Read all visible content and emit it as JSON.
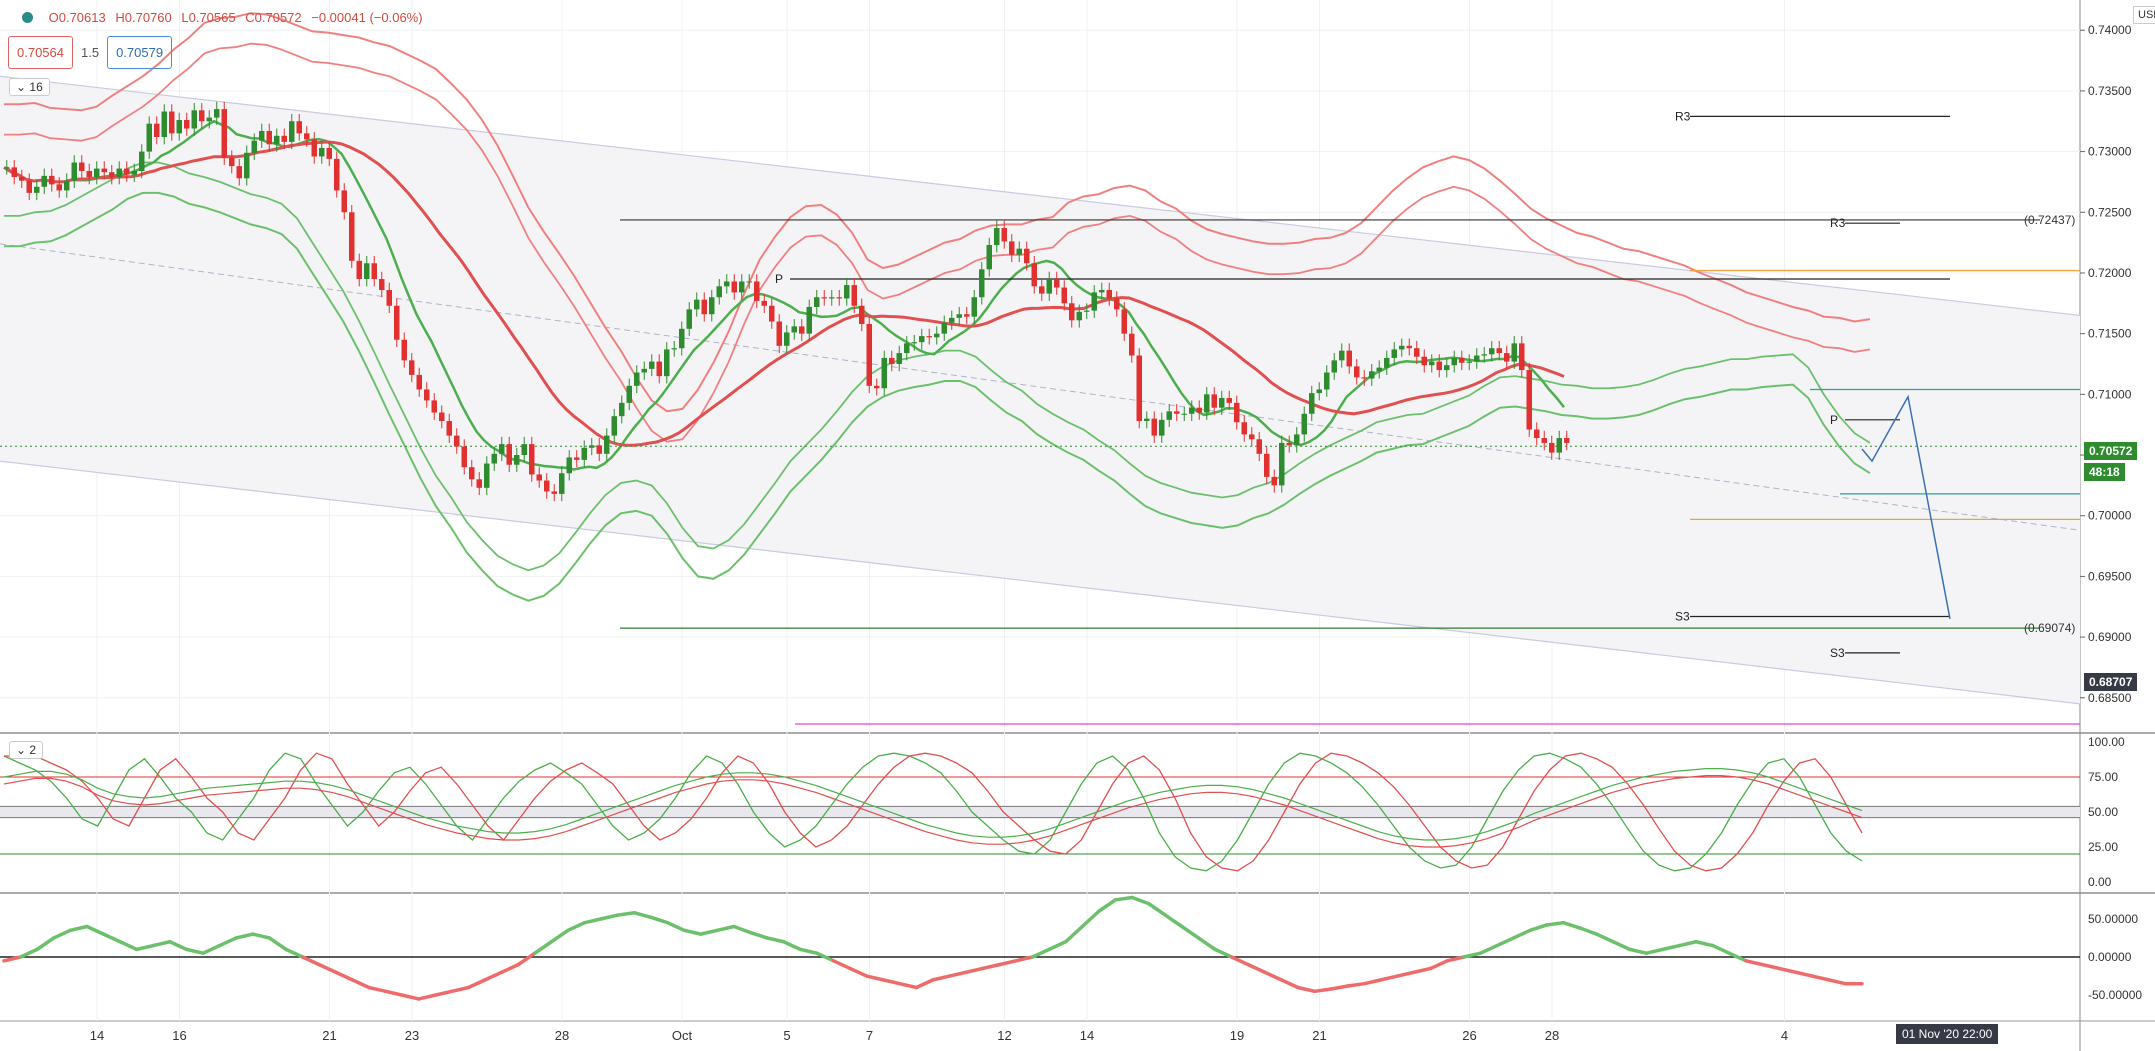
{
  "header": {
    "ohlc": {
      "open": "O0.70613",
      "high": "H0.70760",
      "low": "L0.70565",
      "close": "C0.70572",
      "change": "−0.00041 (−0.06%)"
    },
    "bid": "0.70564",
    "spread": "1.5",
    "ask": "0.70579",
    "indicator_count_main": "16",
    "indicator_count_osc": "2",
    "currency": "USD"
  },
  "price_axis": {
    "labels": [
      "0.74000",
      "0.73500",
      "0.73000",
      "0.72500",
      "0.72000",
      "0.71500",
      "0.71000",
      "0.70500",
      "0.70000",
      "0.69500",
      "0.69000",
      "0.68500"
    ],
    "values": [
      0.74,
      0.735,
      0.73,
      0.725,
      0.72,
      0.715,
      0.71,
      0.705,
      0.7,
      0.695,
      0.69,
      0.685
    ],
    "current_price": "0.70572",
    "countdown": "48:18",
    "crosshair_price": "0.68707"
  },
  "osc_axis": {
    "labels": [
      "100.00",
      "75.00",
      "50.00",
      "25.00",
      "0.00"
    ],
    "values": [
      100,
      75,
      50,
      25,
      0
    ]
  },
  "mom_axis": {
    "labels": [
      "50.00000",
      "0.00000",
      "-50.00000"
    ],
    "values": [
      50,
      0,
      -50
    ]
  },
  "time_axis": {
    "labels": [
      "14",
      "16",
      "21",
      "23",
      "28",
      "Oct",
      "5",
      "7",
      "12",
      "14",
      "19",
      "21",
      "26",
      "28",
      "4"
    ],
    "x_index": [
      12,
      23,
      43,
      54,
      74,
      90,
      104,
      115,
      133,
      144,
      164,
      175,
      195,
      206,
      237
    ],
    "current_date": "01 Nov '20   22:00"
  },
  "levels": {
    "R3_left": {
      "label": "R3",
      "price": 0.7329
    },
    "R3_right": {
      "label": "R3",
      "price": 0.7241
    },
    "S3_left": {
      "label": "S3",
      "price": 0.6917
    },
    "S3_right": {
      "label": "S3",
      "price": 0.6887
    },
    "P_left": {
      "label": "P",
      "price": 0.7195
    },
    "P_right": {
      "label": "P",
      "price": 0.7079
    },
    "high_label": "(0.72437)",
    "low_label": "(0.69074)"
  },
  "chart_data": {
    "type": "candlestick",
    "title": "",
    "colors": {
      "up": "#2e8b2e",
      "down": "#e03030",
      "upper_band": "#f08080",
      "lower_band": "#6cc06c"
    },
    "ylim": [
      0.6835,
      0.7415
    ],
    "closes": [
      0.7287,
      0.7279,
      0.7276,
      0.7266,
      0.7271,
      0.728,
      0.7273,
      0.7268,
      0.7276,
      0.7291,
      0.7284,
      0.7279,
      0.7286,
      0.7283,
      0.7279,
      0.7286,
      0.7281,
      0.7284,
      0.73,
      0.7323,
      0.7312,
      0.7333,
      0.7315,
      0.7326,
      0.7319,
      0.7334,
      0.7325,
      0.7328,
      0.7335,
      0.7295,
      0.7288,
      0.7278,
      0.7299,
      0.7309,
      0.7317,
      0.7306,
      0.7313,
      0.7308,
      0.7325,
      0.7315,
      0.731,
      0.7296,
      0.7303,
      0.7294,
      0.7268,
      0.725,
      0.721,
      0.7195,
      0.7208,
      0.7195,
      0.7186,
      0.7173,
      0.7145,
      0.7128,
      0.7116,
      0.7104,
      0.7095,
      0.7085,
      0.7078,
      0.7066,
      0.7057,
      0.704,
      0.703,
      0.7023,
      0.7043,
      0.7051,
      0.7059,
      0.7042,
      0.705,
      0.7059,
      0.7034,
      0.7029,
      0.702,
      0.7018,
      0.7035,
      0.7048,
      0.7046,
      0.7056,
      0.7058,
      0.7051,
      0.7066,
      0.7082,
      0.7093,
      0.7107,
      0.7118,
      0.7121,
      0.7127,
      0.7115,
      0.7137,
      0.7138,
      0.7154,
      0.717,
      0.7178,
      0.7166,
      0.718,
      0.7189,
      0.7193,
      0.7184,
      0.7193,
      0.7193,
      0.7177,
      0.7173,
      0.716,
      0.714,
      0.7151,
      0.7156,
      0.715,
      0.7172,
      0.718,
      0.7179,
      0.718,
      0.7179,
      0.719,
      0.7173,
      0.7158,
      0.7107,
      0.7105,
      0.713,
      0.7125,
      0.7134,
      0.7142,
      0.7143,
      0.7148,
      0.7147,
      0.715,
      0.7159,
      0.7163,
      0.7166,
      0.7164,
      0.718,
      0.7203,
      0.7223,
      0.7237,
      0.7226,
      0.7215,
      0.722,
      0.7208,
      0.7189,
      0.7183,
      0.7195,
      0.7188,
      0.7175,
      0.7161,
      0.7168,
      0.7169,
      0.7184,
      0.7186,
      0.7179,
      0.717,
      0.715,
      0.7132,
      0.7078,
      0.708,
      0.7066,
      0.7079,
      0.7086,
      0.7084,
      0.7084,
      0.7089,
      0.7085,
      0.71,
      0.7089,
      0.7097,
      0.7093,
      0.7077,
      0.7067,
      0.7063,
      0.7051,
      0.7032,
      0.7025,
      0.706,
      0.7058,
      0.7067,
      0.7084,
      0.7101,
      0.7104,
      0.7118,
      0.7128,
      0.7136,
      0.7123,
      0.7114,
      0.7113,
      0.7119,
      0.7122,
      0.713,
      0.7137,
      0.714,
      0.7138,
      0.7131,
      0.7124,
      0.7127,
      0.712,
      0.7124,
      0.713,
      0.7126,
      0.7127,
      0.7132,
      0.7133,
      0.7138,
      0.7134,
      0.7127,
      0.7142,
      0.712,
      0.7071,
      0.7064,
      0.706,
      0.7052,
      0.7064,
      0.706
    ],
    "band_upper": [
      0.7339,
      0.7339,
      0.734,
      0.7336,
      0.7335,
      0.7334,
      0.7337,
      0.7346,
      0.7354,
      0.7362,
      0.7372,
      0.7384,
      0.7394,
      0.7406,
      0.741,
      0.7411,
      0.7414,
      0.7413,
      0.7409,
      0.7404,
      0.7399,
      0.7398,
      0.7396,
      0.7394,
      0.739,
      0.7387,
      0.7381,
      0.7375,
      0.7368,
      0.7356,
      0.7343,
      0.7326,
      0.7305,
      0.728,
      0.7254,
      0.7234,
      0.7216,
      0.7197,
      0.7176,
      0.7155,
      0.7136,
      0.7114,
      0.7095,
      0.7086,
      0.7088,
      0.7104,
      0.7126,
      0.7152,
      0.7183,
      0.7211,
      0.723,
      0.7246,
      0.7255,
      0.7256,
      0.7248,
      0.7233,
      0.7211,
      0.7204,
      0.7207,
      0.7213,
      0.7219,
      0.7225,
      0.7228,
      0.7235,
      0.7239,
      0.724,
      0.724,
      0.7244,
      0.7246,
      0.7258,
      0.7263,
      0.7265,
      0.727,
      0.7272,
      0.7268,
      0.7259,
      0.7253,
      0.7243,
      0.7236,
      0.7232,
      0.7229,
      0.7226,
      0.7224,
      0.7224,
      0.7225,
      0.7228,
      0.7229,
      0.7233,
      0.7241,
      0.7254,
      0.7267,
      0.7278,
      0.7287,
      0.7292,
      0.7296,
      0.7293,
      0.7286,
      0.7276,
      0.7265,
      0.7253,
      0.7245,
      0.7239,
      0.7233,
      0.723,
      0.7225,
      0.722,
      0.7218,
      0.7214,
      0.721,
      0.7206,
      0.72,
      0.7195,
      0.719,
      0.7184,
      0.718,
      0.7176,
      0.7172,
      0.7169,
      0.7164,
      0.7163,
      0.716,
      0.7162
    ],
    "band_lower": [
      0.7222,
      0.7222,
      0.7225,
      0.7226,
      0.7231,
      0.7238,
      0.7245,
      0.7252,
      0.7261,
      0.7266,
      0.7266,
      0.7263,
      0.7257,
      0.7254,
      0.725,
      0.7245,
      0.724,
      0.7237,
      0.7232,
      0.722,
      0.72,
      0.718,
      0.716,
      0.7136,
      0.711,
      0.7083,
      0.7057,
      0.7031,
      0.7008,
      0.699,
      0.697,
      0.6955,
      0.6942,
      0.6935,
      0.693,
      0.6934,
      0.6944,
      0.696,
      0.6977,
      0.6992,
      0.7002,
      0.7004,
      0.7,
      0.6985,
      0.6965,
      0.695,
      0.6948,
      0.6955,
      0.6968,
      0.6985,
      0.7002,
      0.702,
      0.7033,
      0.7046,
      0.7061,
      0.7077,
      0.709,
      0.7098,
      0.7103,
      0.7106,
      0.7108,
      0.7111,
      0.7111,
      0.7106,
      0.7095,
      0.7085,
      0.7078,
      0.7067,
      0.7059,
      0.7052,
      0.7046,
      0.7037,
      0.7029,
      0.7018,
      0.7008,
      0.7002,
      0.6998,
      0.6994,
      0.6992,
      0.699,
      0.6992,
      0.6998,
      0.7002,
      0.7009,
      0.7018,
      0.7026,
      0.7033,
      0.7039,
      0.7045,
      0.7052,
      0.7055,
      0.7058,
      0.7059,
      0.7064,
      0.7069,
      0.7074,
      0.7082,
      0.7089,
      0.709,
      0.7088,
      0.7086,
      0.7083,
      0.7082,
      0.708,
      0.708,
      0.7081,
      0.7083,
      0.7087,
      0.7092,
      0.7096,
      0.7098,
      0.7101,
      0.7104,
      0.7104,
      0.7106,
      0.7107,
      0.7108,
      0.7097,
      0.7075,
      0.7057,
      0.7043,
      0.7035
    ],
    "oscillator": {
      "fast": [
        90,
        85,
        80,
        72,
        60,
        45,
        40,
        60,
        80,
        88,
        75,
        60,
        50,
        35,
        30,
        45,
        60,
        80,
        92,
        88,
        70,
        55,
        40,
        50,
        65,
        78,
        82,
        70,
        55,
        40,
        30,
        45,
        60,
        72,
        80,
        85,
        78,
        70,
        55,
        40,
        30,
        35,
        45,
        60,
        78,
        90,
        85,
        70,
        50,
        35,
        25,
        30,
        40,
        55,
        70,
        82,
        90,
        92,
        90,
        85,
        78,
        65,
        50,
        40,
        30,
        22,
        20,
        30,
        50,
        70,
        85,
        90,
        80,
        60,
        35,
        18,
        10,
        8,
        15,
        30,
        50,
        70,
        85,
        92,
        90,
        85,
        78,
        68,
        55,
        40,
        25,
        15,
        10,
        12,
        25,
        45,
        65,
        80,
        90,
        92,
        88,
        82,
        70,
        55,
        38,
        22,
        12,
        8,
        10,
        20,
        35,
        55,
        72,
        85,
        88,
        75,
        55,
        35,
        22,
        15
      ],
      "slow": [
        70,
        72,
        74,
        74,
        72,
        68,
        62,
        58,
        56,
        55,
        56,
        58,
        60,
        62,
        63,
        64,
        65,
        66,
        67,
        67,
        66,
        64,
        61,
        57,
        53,
        49,
        45,
        41,
        38,
        35,
        33,
        31,
        30,
        30,
        31,
        33,
        36,
        40,
        44,
        48,
        52,
        56,
        60,
        64,
        67,
        70,
        72,
        73,
        73,
        72,
        70,
        67,
        64,
        60,
        56,
        52,
        48,
        44,
        40,
        36,
        33,
        30,
        28,
        27,
        27,
        28,
        30,
        33,
        37,
        41,
        45,
        49,
        53,
        56,
        59,
        61,
        63,
        64,
        64,
        63,
        61,
        58,
        55,
        51,
        47,
        43,
        39,
        35,
        31,
        28,
        26,
        25,
        25,
        26,
        28,
        31,
        35,
        39,
        44,
        48,
        52,
        56,
        60,
        64,
        67,
        70,
        72,
        74,
        75,
        76,
        76,
        75,
        73,
        70,
        66,
        62,
        58,
        54,
        50,
        46
      ]
    },
    "momentum": [
      -5,
      0,
      10,
      25,
      35,
      40,
      30,
      20,
      10,
      15,
      20,
      10,
      5,
      15,
      25,
      30,
      25,
      10,
      0,
      -10,
      -20,
      -30,
      -40,
      -45,
      -50,
      -55,
      -50,
      -45,
      -40,
      -30,
      -20,
      -10,
      5,
      20,
      35,
      45,
      50,
      55,
      58,
      52,
      45,
      35,
      30,
      35,
      40,
      32,
      25,
      20,
      10,
      5,
      -5,
      -15,
      -25,
      -30,
      -35,
      -40,
      -30,
      -25,
      -20,
      -15,
      -10,
      -5,
      0,
      10,
      20,
      40,
      60,
      75,
      78,
      70,
      55,
      40,
      25,
      10,
      0,
      -10,
      -20,
      -30,
      -40,
      -45,
      -42,
      -38,
      -35,
      -30,
      -25,
      -20,
      -15,
      -5,
      0,
      5,
      15,
      25,
      35,
      42,
      45,
      38,
      30,
      20,
      10,
      5,
      10,
      15,
      20,
      15,
      5,
      -5,
      -10,
      -15,
      -20,
      -25,
      -30,
      -35,
      -35
    ]
  }
}
